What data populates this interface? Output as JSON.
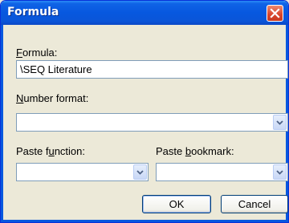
{
  "window": {
    "title": "Formula",
    "close_icon": "close-icon",
    "title_color": "#0758df",
    "close_color": "#d9432b"
  },
  "formula": {
    "label_accel": "F",
    "label_rest": "ormula:",
    "value": "\\SEQ Literature"
  },
  "number_format": {
    "label_accel": "N",
    "label_rest": "umber format:",
    "value": ""
  },
  "paste_function": {
    "label_pre": "Paste f",
    "label_accel": "u",
    "label_rest": "nction:",
    "value": ""
  },
  "paste_bookmark": {
    "label_pre": "Paste ",
    "label_accel": "b",
    "label_rest": "ookmark:",
    "value": ""
  },
  "buttons": {
    "ok": "OK",
    "cancel": "Cancel"
  }
}
